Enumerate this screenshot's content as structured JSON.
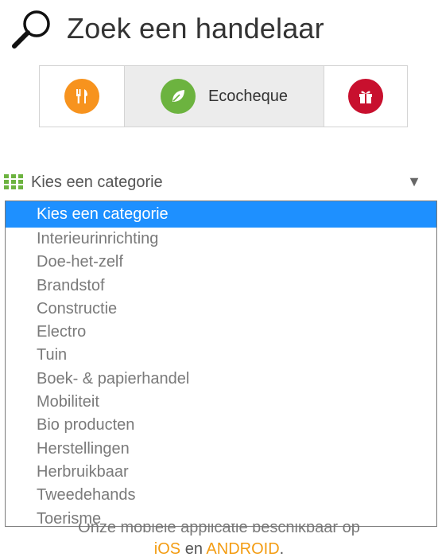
{
  "header": {
    "title": "Zoek een handelaar",
    "icon": "search-icon"
  },
  "tabs": [
    {
      "label": "",
      "icon": "fork-knife-icon",
      "color": "#f7931e"
    },
    {
      "label": "Ecocheque",
      "icon": "leaf-icon",
      "color": "#6cb33f",
      "active": true
    },
    {
      "label": "",
      "icon": "gift-icon",
      "color": "#c8102e"
    }
  ],
  "category": {
    "icon": "grid-icon",
    "icon_color": "#6cb33f",
    "label": "Kies een categorie",
    "arrow": "▼",
    "options": [
      "Kies een categorie",
      "Interieurinrichting",
      "Doe-het-zelf",
      "Brandstof",
      "Constructie",
      "Electro",
      "Tuin",
      "Boek- & papierhandel",
      "Mobiliteit",
      "Bio producten",
      "Herstellingen",
      "Herbruikbaar",
      "Tweedehands",
      "Toerisme"
    ],
    "selected_index": 0,
    "selected_color": "#1e90ff"
  },
  "footer": {
    "line1": "Onze mobiele applicatie beschikbaar op",
    "ios": "iOS",
    "connector": "en",
    "android": "ANDROID",
    "period": ".",
    "link_color": "#f39c12"
  }
}
